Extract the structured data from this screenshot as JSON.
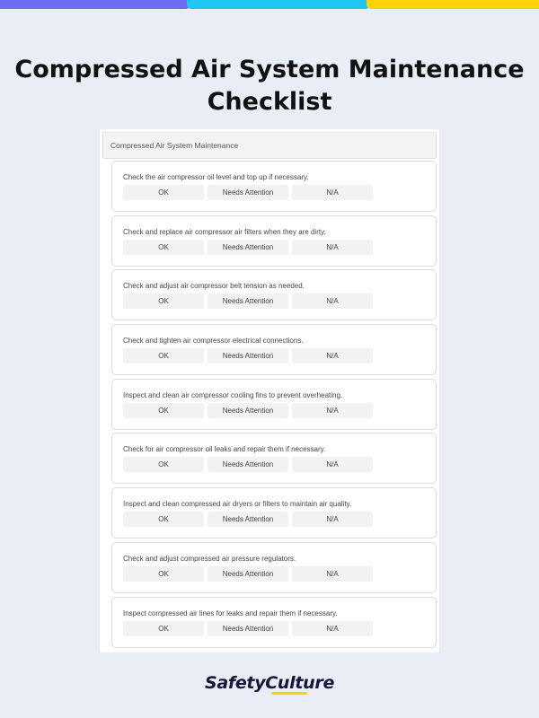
{
  "title": "Compressed Air System Maintenance Checklist",
  "panel_header": "Compressed Air System Maintenance",
  "options": [
    "OK",
    "Needs Attention",
    "N/A"
  ],
  "items": [
    {
      "text": "Check the air compressor oil level and top up if necessary."
    },
    {
      "text": "Check and replace air compressor air filters when they are dirty."
    },
    {
      "text": "Check and adjust air compressor belt tension as needed."
    },
    {
      "text": "Check and tighten air compressor electrical connections."
    },
    {
      "text": "Inspect and clean air compressor cooling fins to prevent overheating."
    },
    {
      "text": "Check for air compressor oil leaks and repair them if necessary."
    },
    {
      "text": "Inspect and clean compressed air dryers or filters to maintain air quality."
    },
    {
      "text": "Check and adjust compressed air pressure regulators."
    },
    {
      "text": "Inspect compressed air lines for leaks and repair them if necessary."
    }
  ],
  "brand": "SafetyCulture",
  "colors": {
    "accent_purple": "#6f6cf6",
    "accent_cyan": "#1ec7ef",
    "accent_yellow": "#ffd20a",
    "background": "#e9edf6"
  }
}
